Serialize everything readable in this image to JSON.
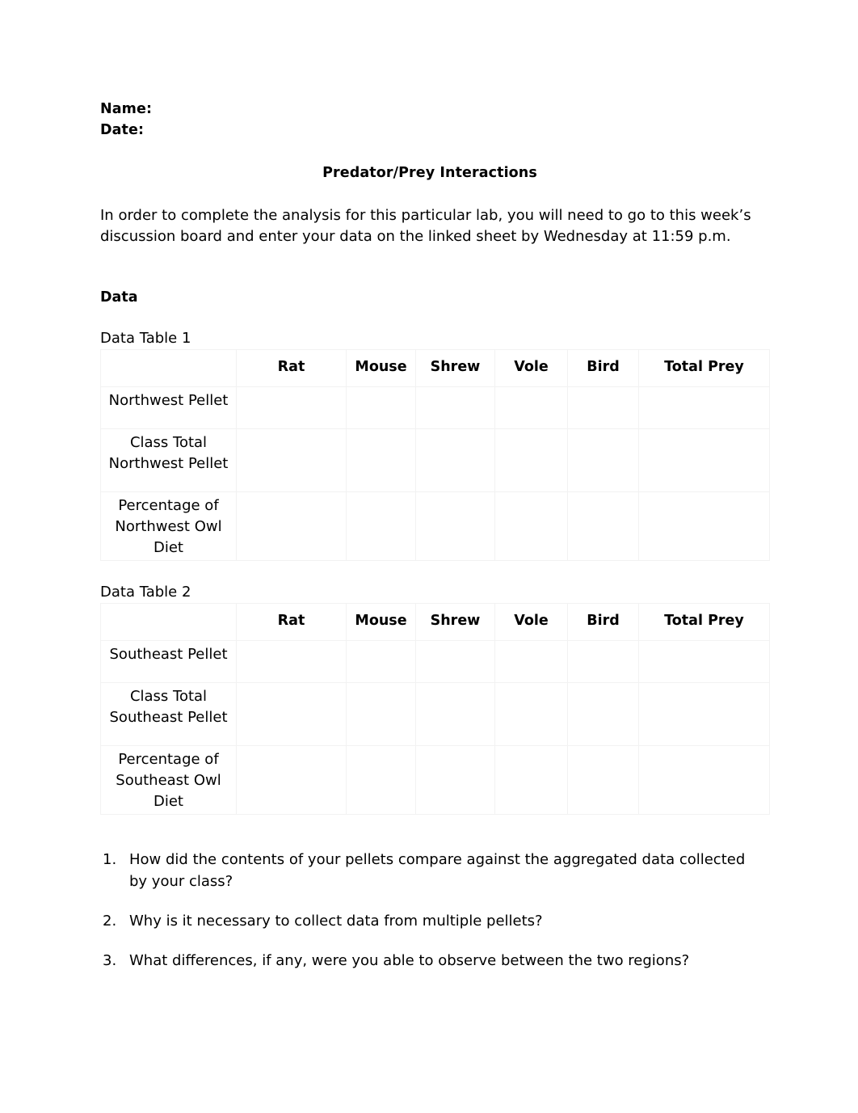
{
  "header": {
    "name_label": "Name:",
    "date_label": "Date:"
  },
  "title": "Predator/Prey Interactions",
  "intro": "In order to complete the analysis for this particular lab, you will need to go to this week’s discussion board and enter your data on the linked sheet by Wednesday at 11:59 p.m.",
  "data_section": {
    "heading": "Data",
    "table1": {
      "caption": "Data Table 1",
      "corner": "",
      "columns": [
        "Rat",
        "Mouse",
        "Shrew",
        "Vole",
        "Bird",
        "Total Prey"
      ],
      "rows": [
        {
          "label": "Northwest Pellet",
          "cells": [
            "",
            "",
            "",
            "",
            "",
            ""
          ]
        },
        {
          "label": "Class Total Northwest Pellet",
          "cells": [
            "",
            "",
            "",
            "",
            "",
            ""
          ]
        },
        {
          "label": "Percentage of Northwest Owl Diet",
          "cells": [
            "",
            "",
            "",
            "",
            "",
            ""
          ]
        }
      ]
    },
    "table2": {
      "caption": "Data Table 2",
      "corner": "",
      "columns": [
        "Rat",
        "Mouse",
        "Shrew",
        "Vole",
        "Bird",
        "Total Prey"
      ],
      "rows": [
        {
          "label": "Southeast Pellet",
          "cells": [
            "",
            "",
            "",
            "",
            "",
            ""
          ]
        },
        {
          "label": "Class Total Southeast Pellet",
          "cells": [
            "",
            "",
            "",
            "",
            "",
            ""
          ]
        },
        {
          "label": "Percentage of Southeast Owl Diet",
          "cells": [
            "",
            "",
            "",
            "",
            "",
            ""
          ]
        }
      ]
    }
  },
  "questions": [
    {
      "num": "1.",
      "text": "How did the contents of your pellets compare against the aggregated data collected by your class?"
    },
    {
      "num": "2.",
      "text": "Why is it necessary to collect data from multiple pellets?"
    },
    {
      "num": "3.",
      "text": "What differences, if any, were you able to observe between the two regions?"
    }
  ],
  "colors": {
    "page_background": "#ffffff",
    "text": "#000000",
    "table_border": "#f2f2f2"
  }
}
